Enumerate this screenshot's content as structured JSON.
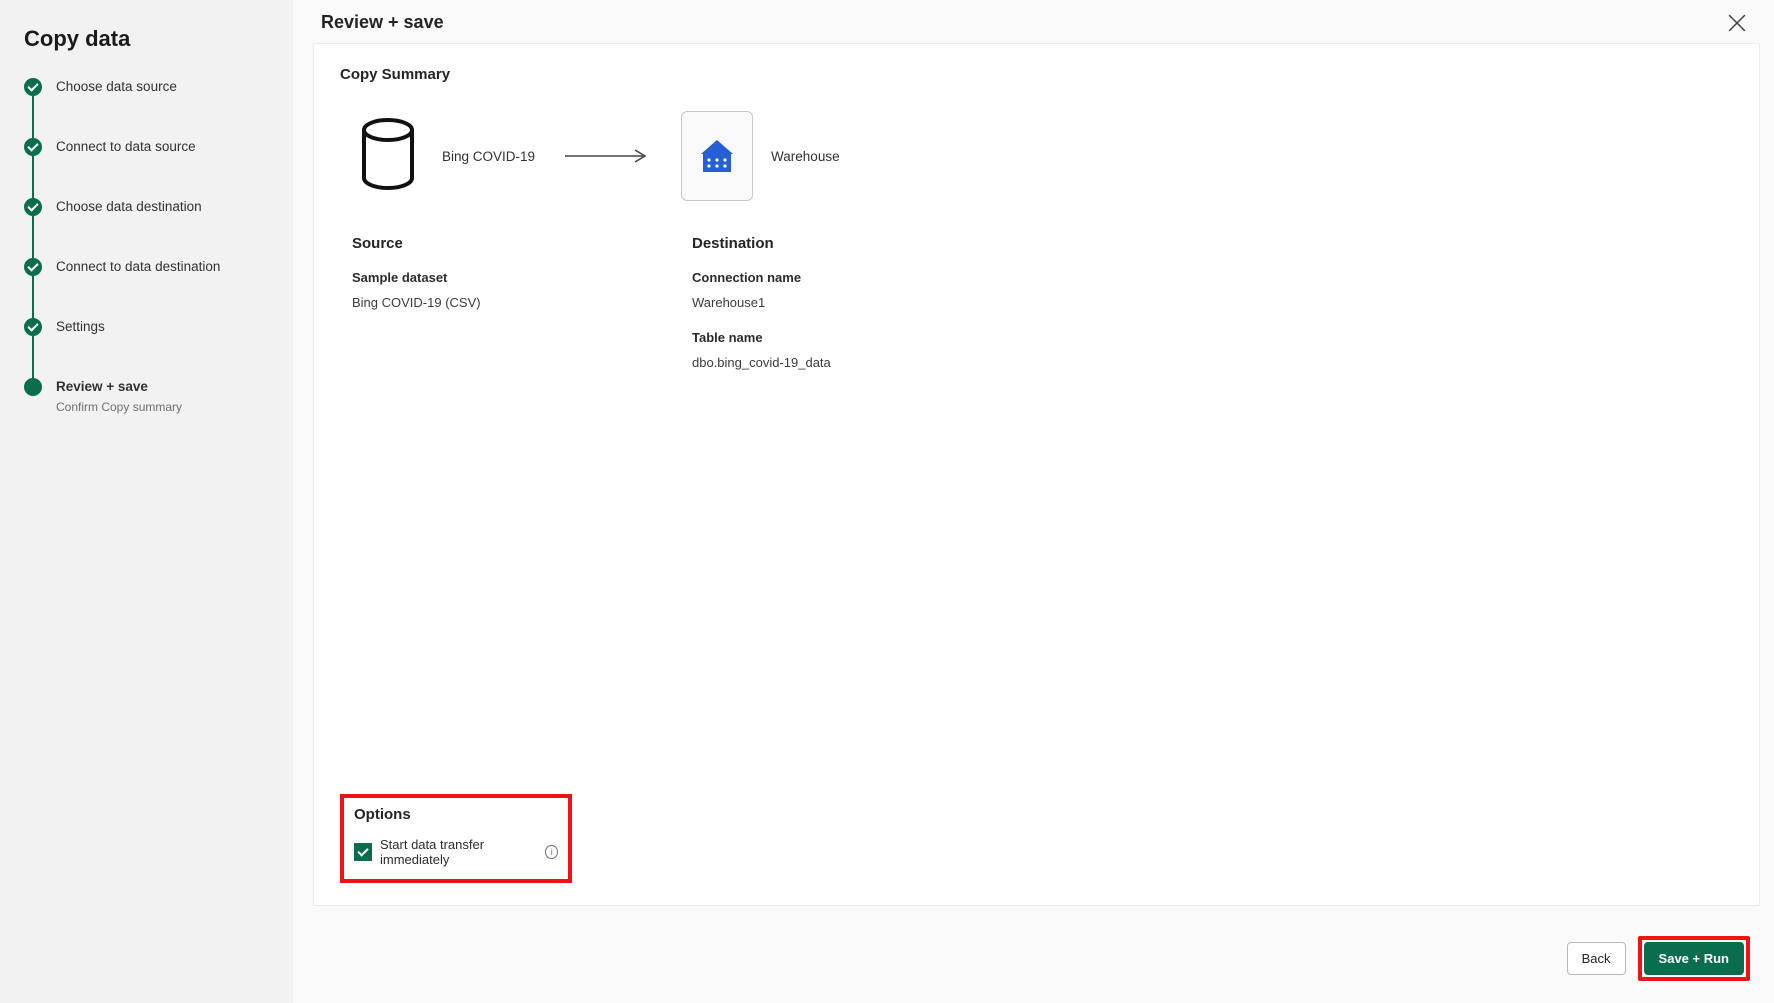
{
  "sidebar": {
    "title": "Copy data",
    "steps": [
      {
        "label": "Choose data source",
        "state": "done"
      },
      {
        "label": "Connect to data source",
        "state": "done"
      },
      {
        "label": "Choose data destination",
        "state": "done"
      },
      {
        "label": "Connect to data destination",
        "state": "done"
      },
      {
        "label": "Settings",
        "state": "done"
      },
      {
        "label": "Review + save",
        "state": "current",
        "sub": "Confirm Copy summary"
      }
    ]
  },
  "header": {
    "title": "Review + save"
  },
  "summary": {
    "heading": "Copy Summary",
    "source_node_label": "Bing COVID-19",
    "dest_node_label": "Warehouse",
    "source_section": "Source",
    "dest_section": "Destination",
    "source_fields": {
      "sample_dataset_label": "Sample dataset",
      "sample_dataset_value": "Bing COVID-19 (CSV)"
    },
    "dest_fields": {
      "connection_label": "Connection name",
      "connection_value": "Warehouse1",
      "table_label": "Table name",
      "table_value": "dbo.bing_covid-19_data"
    }
  },
  "options": {
    "heading": "Options",
    "checkbox_label": "Start data transfer immediately",
    "checked": true
  },
  "footer": {
    "back": "Back",
    "save_run": "Save + Run"
  }
}
